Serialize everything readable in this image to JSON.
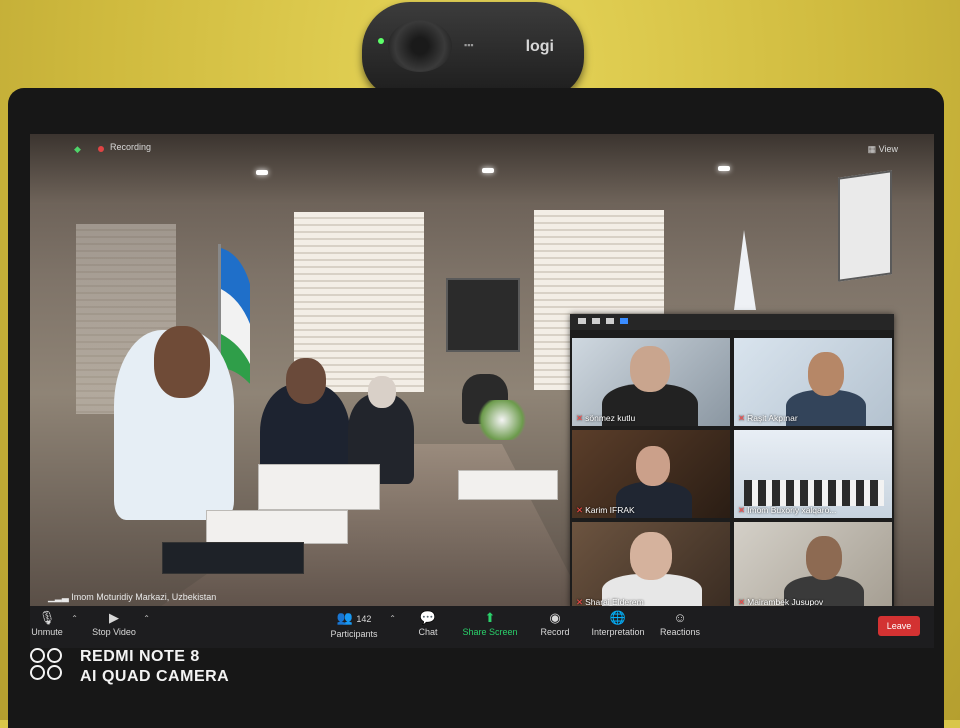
{
  "overlay": {
    "recording_label": "Recording",
    "view_label": "View",
    "active_speaker_name": "Imom Moturidiy Markazi, Uzbekistan"
  },
  "gallery": {
    "tiles": [
      {
        "name": "sönmez kutlu"
      },
      {
        "name": "Raşit Akpınar"
      },
      {
        "name": "Karim IFRAK"
      },
      {
        "name": "Imom Buxoriy xalqaro..."
      },
      {
        "name": "Sharai Elderem"
      },
      {
        "name": "Mairambek Jusupov"
      }
    ]
  },
  "toolbar": {
    "unmute": "Unmute",
    "stop_video": "Stop Video",
    "participants": "Participants",
    "participants_count": "142",
    "chat": "Chat",
    "share_screen": "Share Screen",
    "record": "Record",
    "interpretation": "Interpretation",
    "reactions": "Reactions",
    "leave": "Leave"
  },
  "webcam": {
    "brand": "logi"
  },
  "watermark": {
    "line1": "REDMI NOTE 8",
    "line2": "AI QUAD CAMERA"
  },
  "colors": {
    "share_green": "#2ad06a",
    "leave_red": "#d33232",
    "mute_red": "#ff4a4a",
    "gallery_selected": "#3a8cff"
  }
}
